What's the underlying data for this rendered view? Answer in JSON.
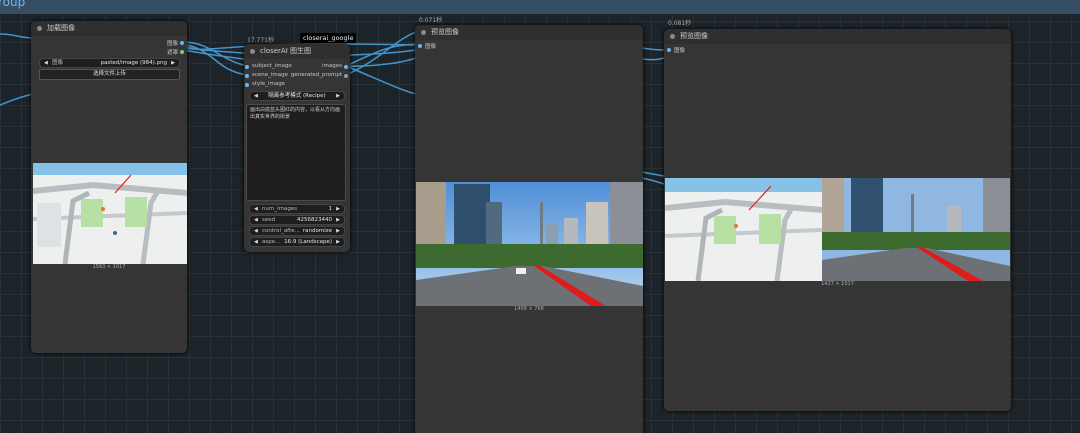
{
  "group": {
    "title": "roup"
  },
  "load_node": {
    "title": "加载图像",
    "outputs": [
      "图像",
      "遮罩"
    ],
    "image_widget": {
      "name": "图像",
      "value": "pasted/image (984).png"
    },
    "upload_button": "选择文件上传",
    "size_caption": "1563 × 1017"
  },
  "gen_node": {
    "time": "17.771秒",
    "badge": "closerai_google",
    "title": "closerAI 图生图",
    "inputs": [
      "subject_image",
      "scene_image",
      "style_image"
    ],
    "outputs": [
      "images",
      "generated_prompt"
    ],
    "mode": "隔离参考模式 (Recipe)",
    "prompt": "画出白底蓝头图红的内容，以看从方向画出真实世界的街景",
    "num_images": {
      "name": "num_images",
      "value": "1"
    },
    "seed": {
      "name": "seed",
      "value": "4256823440"
    },
    "control": {
      "name": "control_afte...",
      "value": "randomize"
    },
    "aspect": {
      "name": "aspe...",
      "value": "16:9 (Landscape)"
    }
  },
  "preview1": {
    "time": "0.071秒",
    "title": "预览图像",
    "input": "图像",
    "size_caption": "1408 × 768"
  },
  "preview2": {
    "time": "0.081秒",
    "title": "预览图像",
    "input": "图像",
    "size_caption": "1427 × 1017"
  },
  "colors": {
    "wire": "#4aa0dc",
    "image_socket": "#64b5f6",
    "mask_socket": "#81c784",
    "background": "#1c2429"
  }
}
